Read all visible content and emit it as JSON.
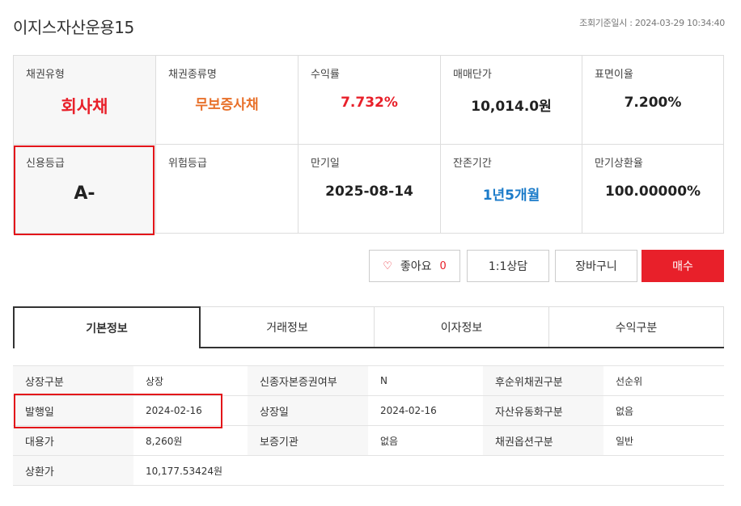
{
  "header": {
    "title": "이지스자산운용15",
    "ref_label": "조회기준일시 : 2024-03-29 10:34:40"
  },
  "summary": {
    "cells": [
      {
        "label": "채권유형",
        "value": "회사채"
      },
      {
        "label": "채권종류명",
        "value": "무보증사채"
      },
      {
        "label": "수익률",
        "value": "7.732%"
      },
      {
        "label": "매매단가",
        "value": "10,014.0원"
      },
      {
        "label": "표면이율",
        "value": "7.200%"
      },
      {
        "label": "신용등급",
        "value": "A-"
      },
      {
        "label": "위험등급",
        "value": ""
      },
      {
        "label": "만기일",
        "value": "2025-08-14"
      },
      {
        "label": "잔존기간",
        "value": "1년5개월"
      },
      {
        "label": "만기상환율",
        "value": "100.00000%"
      }
    ]
  },
  "actions": {
    "like_label": "좋아요",
    "like_count": "0",
    "consult_label": "1:1상담",
    "cart_label": "장바구니",
    "buy_label": "매수"
  },
  "tabs": [
    "기본정보",
    "거래정보",
    "이자정보",
    "수익구분"
  ],
  "info_rows": [
    [
      {
        "k": "상장구분",
        "v": "상장"
      },
      {
        "k": "신종자본증권여부",
        "v": "N"
      },
      {
        "k": "후순위채권구분",
        "v": "선순위"
      }
    ],
    [
      {
        "k": "발행일",
        "v": "2024-02-16"
      },
      {
        "k": "상장일",
        "v": "2024-02-16"
      },
      {
        "k": "자산유동화구분",
        "v": "없음"
      }
    ],
    [
      {
        "k": "대용가",
        "v": "8,260원"
      },
      {
        "k": "보증기관",
        "v": "없음"
      },
      {
        "k": "채권옵션구분",
        "v": "일반"
      }
    ],
    [
      {
        "k": "상환가",
        "v": "10,177.53424원"
      }
    ]
  ],
  "colors": {
    "accent_red": "#e8202a",
    "orange": "#e8702a",
    "blue": "#1b7bc9",
    "highlight": "#e3151a"
  },
  "icons": {
    "like": "heart-outline-icon"
  }
}
